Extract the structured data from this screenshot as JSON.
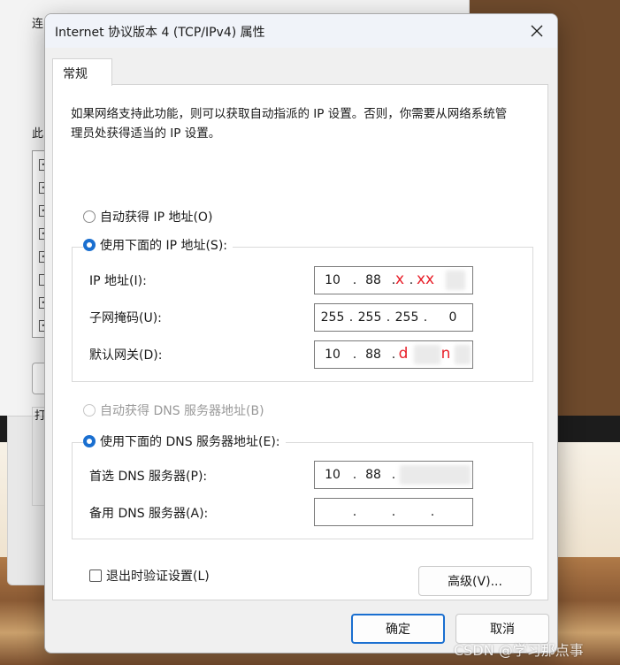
{
  "background": {
    "window_fragments": [
      "连",
      "此",
      "打"
    ]
  },
  "dialog": {
    "title": "Internet 协议版本 4 (TCP/IPv4) 属性",
    "tab_label": "常规",
    "description": "如果网络支持此功能，则可以获取自动指派的 IP 设置。否则，你需要从网络系统管理员处获得适当的 IP 设置。",
    "ip_mode": {
      "auto_label": "自动获得 IP 地址(O)",
      "manual_label": "使用下面的 IP 地址(S):",
      "selected": "manual"
    },
    "ip_fields": {
      "ip_label": "IP 地址(I):",
      "ip_value": [
        "10",
        "88",
        "x",
        "xx"
      ],
      "mask_label": "子网掩码(U):",
      "mask_value": [
        "255",
        "255",
        "255",
        "0"
      ],
      "gateway_label": "默认网关(D):",
      "gateway_value": [
        "10",
        "88",
        "d",
        "n"
      ]
    },
    "dns_mode": {
      "auto_label": "自动获得 DNS 服务器地址(B)",
      "manual_label": "使用下面的 DNS 服务器地址(E):",
      "selected": "manual"
    },
    "dns_fields": {
      "preferred_label": "首选 DNS 服务器(P):",
      "preferred_value": [
        "10",
        "88",
        "",
        ""
      ],
      "alternate_label": "备用 DNS 服务器(A):",
      "alternate_value": [
        "",
        "",
        "",
        ""
      ]
    },
    "validate_label": "退出时验证设置(L)",
    "validate_checked": false,
    "advanced_label": "高级(V)...",
    "ok_label": "确定",
    "cancel_label": "取消"
  },
  "watermark": "CSDN @学习那点事",
  "colors": {
    "accent": "#1a6fd0",
    "annotation_red": "#e8202a"
  }
}
